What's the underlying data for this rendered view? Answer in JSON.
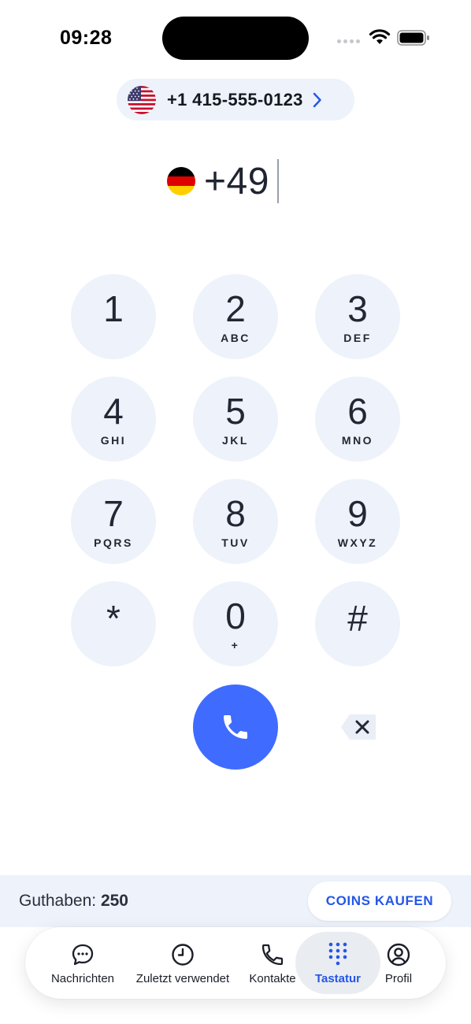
{
  "status_bar": {
    "time": "09:28"
  },
  "caller_id": {
    "number": "+1 415-555-0123",
    "flag_icon": "us-flag-icon"
  },
  "dial": {
    "value": "+49",
    "flag_icon": "de-flag-icon"
  },
  "keypad": {
    "keys": [
      {
        "digit": "1",
        "letters": ""
      },
      {
        "digit": "2",
        "letters": "ABC"
      },
      {
        "digit": "3",
        "letters": "DEF"
      },
      {
        "digit": "4",
        "letters": "GHI"
      },
      {
        "digit": "5",
        "letters": "JKL"
      },
      {
        "digit": "6",
        "letters": "MNO"
      },
      {
        "digit": "7",
        "letters": "PQRS"
      },
      {
        "digit": "8",
        "letters": "TUV"
      },
      {
        "digit": "9",
        "letters": "WXYZ"
      },
      {
        "digit": "*",
        "letters": ""
      },
      {
        "digit": "0",
        "letters": "+"
      },
      {
        "digit": "#",
        "letters": ""
      }
    ]
  },
  "balance": {
    "label": "Guthaben:",
    "value": "250",
    "buy_button": "COINS KAUFEN"
  },
  "tabs": [
    {
      "label": "Nachrichten",
      "icon": "chat-bubble-icon"
    },
    {
      "label": "Zuletzt verwendet",
      "icon": "clock-icon"
    },
    {
      "label": "Kontakte",
      "icon": "phone-icon"
    },
    {
      "label": "Tastatur",
      "icon": "keypad-icon",
      "active": true
    },
    {
      "label": "Profil",
      "icon": "profile-icon"
    }
  ],
  "colors": {
    "accent": "#3f6bff",
    "accent_text": "#2456e8",
    "key_bg": "#edf2fb",
    "background": "#ffffff"
  }
}
